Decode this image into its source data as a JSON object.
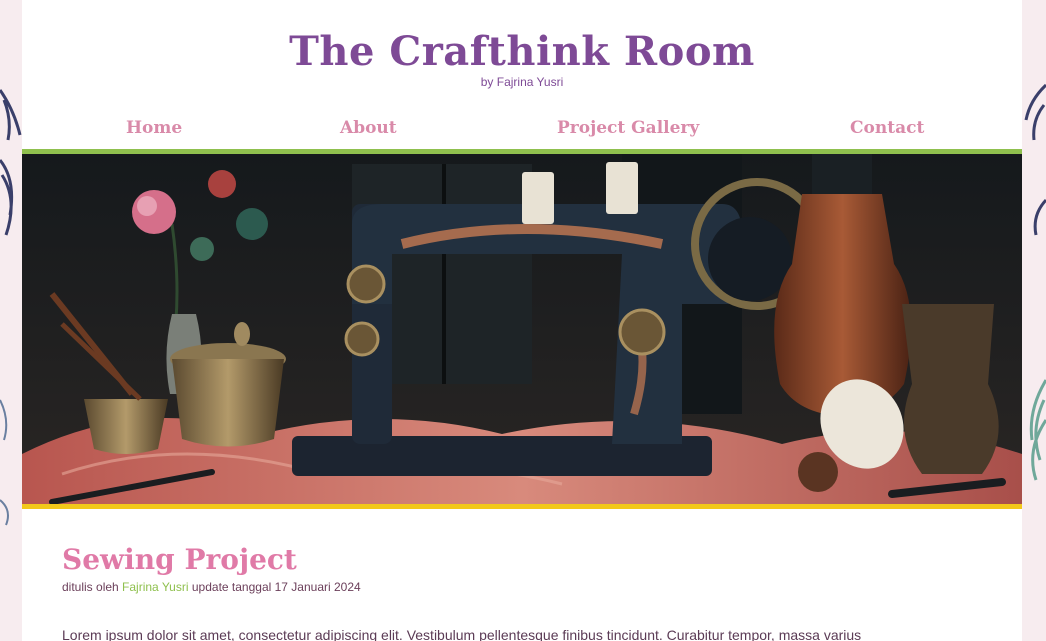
{
  "site": {
    "title": "The Crafthink Room",
    "byline": "by Fajrina Yusri"
  },
  "nav": {
    "items": [
      {
        "label": "Home"
      },
      {
        "label": "About"
      },
      {
        "label": "Project Gallery"
      },
      {
        "label": "Contact"
      }
    ]
  },
  "hero": {
    "image": "vintage-sewing-machine-photo"
  },
  "post": {
    "title": "Sewing Project",
    "meta_prefix": "ditulis oleh",
    "author": "Fajrina Yusri",
    "meta_suffix": "update tanggal 17 Januari 2024",
    "body": "Lorem ipsum dolor sit amet, consectetur adipiscing elit. Vestibulum pellentesque finibus tincidunt. Curabitur tempor, massa varius"
  },
  "colors": {
    "title_purple": "#7e4a96",
    "nav_pink": "#d98aa9",
    "post_title_pink": "#e07aa7",
    "accent_green": "#8fc04e",
    "accent_yellow": "#f2c81a",
    "background": "#f7ecef"
  }
}
